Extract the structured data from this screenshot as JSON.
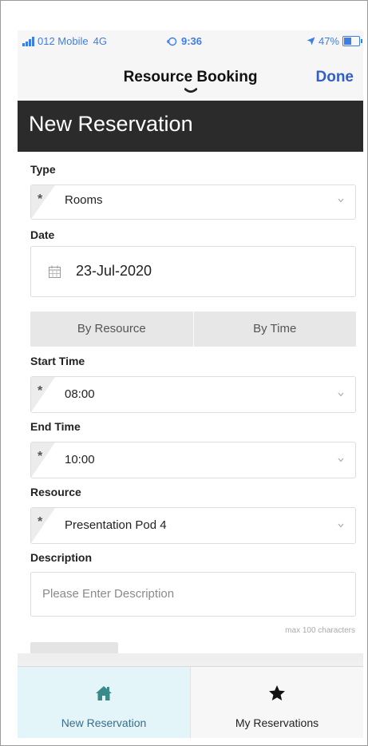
{
  "status": {
    "carrier": "012 Mobile",
    "network": "4G",
    "time": "9:36",
    "battery": "47%"
  },
  "nav": {
    "title": "Resource Booking",
    "done_label": "Done"
  },
  "header": {
    "title": "New Reservation"
  },
  "form": {
    "type": {
      "label": "Type",
      "value": "Rooms"
    },
    "date": {
      "label": "Date",
      "value": "23-Jul-2020"
    },
    "mode_tabs": [
      "By Resource",
      "By Time"
    ],
    "start_time": {
      "label": "Start Time",
      "value": "08:00"
    },
    "end_time": {
      "label": "End Time",
      "value": "10:00"
    },
    "resource": {
      "label": "Resource",
      "value": "Presentation Pod 4"
    },
    "description": {
      "label": "Description",
      "placeholder": "Please Enter Description",
      "hint": "max 100 characters"
    },
    "required_marker": "*"
  },
  "tabbar": {
    "items": [
      {
        "label": "New Reservation",
        "icon": "home-icon",
        "active": true
      },
      {
        "label": "My Reservations",
        "icon": "star-icon",
        "active": false
      }
    ]
  },
  "colors": {
    "header_bg": "#2b2b2b",
    "accent_blue": "#2f5fc7",
    "status_blue": "#3f7de6",
    "tab_active_bg": "#e4f5f9",
    "home_icon": "#3b8a8a"
  }
}
